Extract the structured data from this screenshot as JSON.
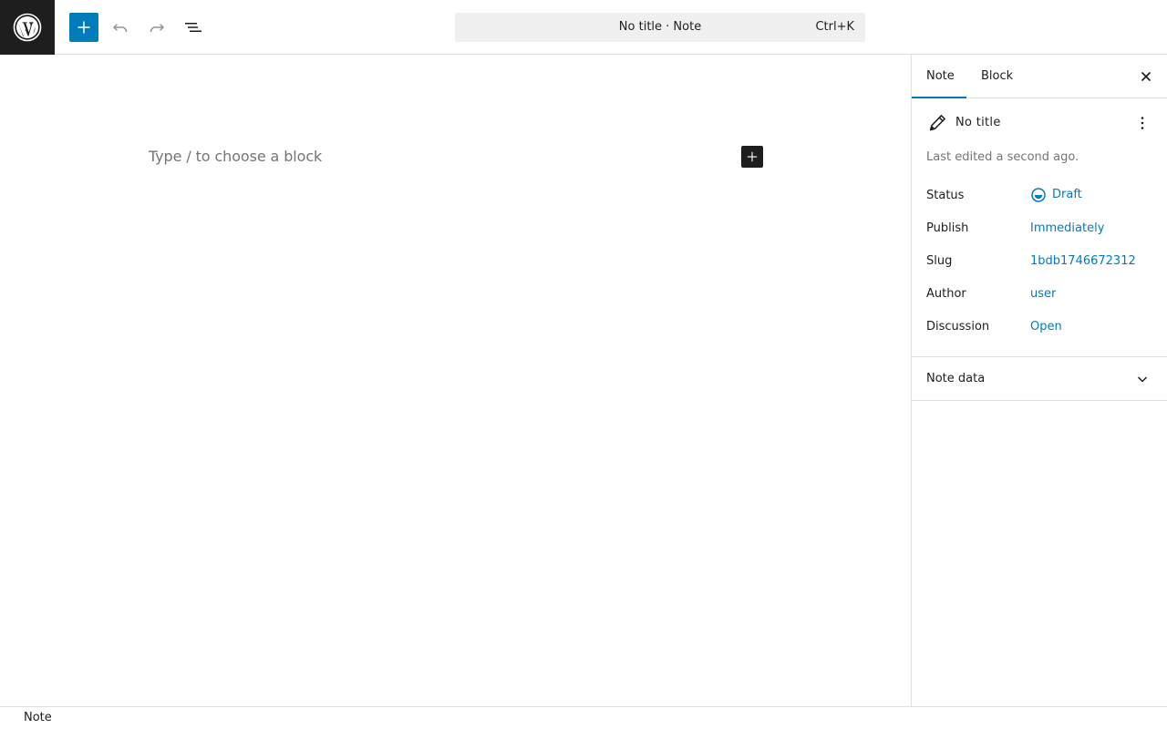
{
  "toolbar": {
    "logo_icon": "wordpress-icon",
    "inserter_icon": "plus-icon",
    "undo_icon": "undo-icon",
    "redo_icon": "redo-icon",
    "list_view_icon": "list-view-icon",
    "accent_color": "#007cba"
  },
  "command_bar": {
    "title": "No title · Note",
    "shortcut": "Ctrl+K"
  },
  "canvas": {
    "placeholder": "Type / to choose a block",
    "add_block_icon": "plus-icon"
  },
  "sidebar": {
    "tabs": [
      {
        "label": "Note",
        "active": true
      },
      {
        "label": "Block",
        "active": false
      }
    ],
    "close_icon": "close-icon",
    "summary": {
      "icon": "pencil-icon",
      "title": "No title",
      "more_icon": "more-vertical-icon",
      "last_edited": "Last edited a second ago."
    },
    "rows": {
      "status": {
        "label": "Status",
        "value": "Draft",
        "icon": "draft-status-icon"
      },
      "publish": {
        "label": "Publish",
        "value": "Immediately"
      },
      "slug": {
        "label": "Slug",
        "value": "1bdb1746672312"
      },
      "author": {
        "label": "Author",
        "value": "user"
      },
      "discussion": {
        "label": "Discussion",
        "value": "Open"
      }
    },
    "panels": [
      {
        "title": "Note data",
        "icon": "chevron-down-icon",
        "expanded": false
      }
    ]
  },
  "footer": {
    "breadcrumb": "Note"
  }
}
